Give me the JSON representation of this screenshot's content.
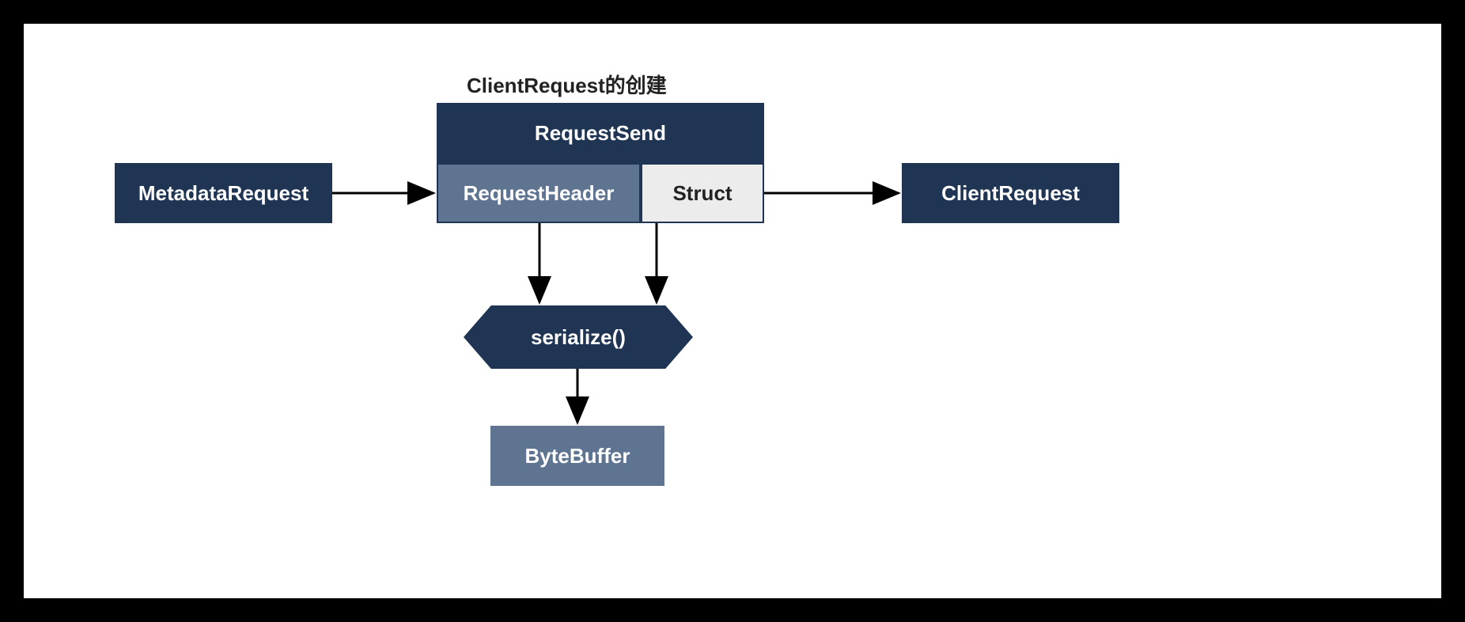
{
  "title": "ClientRequest的创建",
  "nodes": {
    "metadata_request": "MetadataRequest",
    "request_send": "RequestSend",
    "request_header": "RequestHeader",
    "struct": "Struct",
    "client_request": "ClientRequest",
    "serialize": "serialize()",
    "byte_buffer": "ByteBuffer"
  }
}
